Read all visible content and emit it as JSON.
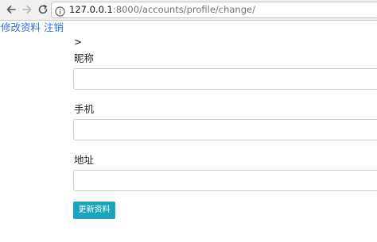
{
  "browser": {
    "url_host": "127.0.0.1",
    "url_rest": ":8000/accounts/profile/change/"
  },
  "nav": {
    "edit_profile": "修改资料",
    "logout": "注销"
  },
  "breadcrumb": ">",
  "form": {
    "nickname_label": "昵称",
    "nickname_value": "",
    "phone_label": "手机",
    "phone_value": "",
    "address_label": "地址",
    "address_value": "",
    "submit_label": "更新资料"
  },
  "colors": {
    "link": "#2a6fe6",
    "button": "#1aa5b8"
  }
}
